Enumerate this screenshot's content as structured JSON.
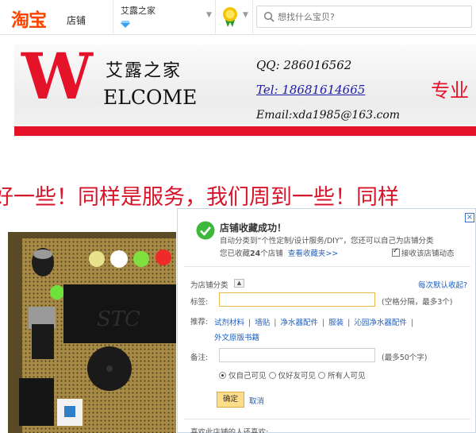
{
  "topbar": {
    "logo_text": "淘宝",
    "logo_sub": "店铺",
    "shop_name": "艾露之家",
    "search_placeholder": "想找什么宝贝?"
  },
  "banner": {
    "welcome_big": "W",
    "welcome_rest": "ELCOME",
    "shop_cn": "艾露之家",
    "qq": "QQ:  286016562",
    "tel": "Tel: 18681614665",
    "email": "Email:xda1985@163.com",
    "slogan_right": "专业"
  },
  "marquee": {
    "text": "好一些！同样是服务，我们周到一些！同样"
  },
  "dialog": {
    "close": "×",
    "title": "店铺收藏成功！",
    "line1": "自动分类到“个性定制/设计服务/DIY”，您还可以自己为店铺分类",
    "line2_prefix": "您已收藏",
    "line2_count": "24",
    "line2_suffix": "个店铺",
    "view_favorites": "查看收藏夹>>",
    "receive_updates": "接收该店铺动态",
    "category_label": "为店铺分类",
    "category_toggle": "▲",
    "default_category": "每次默认收起?",
    "tag_label": "标签:",
    "tag_value": "",
    "tag_hint": "(空格分隔，最多3个)",
    "recommend_label": "推荐:",
    "recommend_items": [
      "试剂材料",
      "墙贴",
      "净水器配件",
      "服装",
      "沁园净水器配件",
      "外文原版书籍"
    ],
    "note_label": "备注:",
    "note_value": "",
    "note_hint": "(最多50个字)",
    "visibility": [
      "仅自己可见",
      "仅好友可见",
      "所有人可见"
    ],
    "confirm_button": "确定",
    "cancel_button": "取消",
    "also_liked": "喜欢此店铺的人还喜欢:"
  },
  "colors": {
    "taobao_orange": "#ff4400",
    "banner_red": "#e4132a",
    "link_blue": "#1f5fbf",
    "confirm_button_bg": "#fddd8a"
  }
}
